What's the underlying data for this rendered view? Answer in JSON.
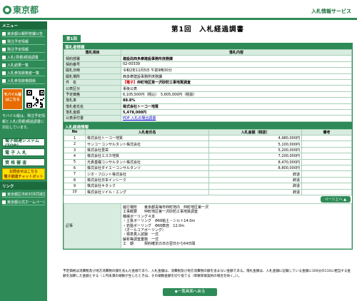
{
  "header": {
    "logo_text": "東京都",
    "service_title": "入札情報サービス"
  },
  "sidebar": {
    "menu_title": "メニュー",
    "items": [
      {
        "label": "東京都公報所管課公告"
      },
      {
        "label": "発注予定情報"
      },
      {
        "label": "発注予定情報"
      },
      {
        "label": "入札(見積)経過調書"
      },
      {
        "label": "入札結果一覧"
      },
      {
        "label": "入札参加資格者一覧"
      },
      {
        "label": "入札参加資格関係"
      }
    ],
    "mobile_button": "モバイル版はこちら",
    "mobile_text": "モバイル版は、発注予定情報と入札(見積)経過調書に対応しています。",
    "links": [
      {
        "label": "電子調達システム(TOP)"
      },
      {
        "label": "電 子 入 札"
      },
      {
        "label": "資 格 審 査"
      }
    ],
    "yellow_button_line1": "お問合せはこちら",
    "yellow_button_line2": "電子調達チャットボット",
    "links_title": "リンク",
    "link_items": [
      {
        "label": "東京都区市町村共同運営"
      },
      {
        "label": "東京都公式ホームページ"
      }
    ]
  },
  "main": {
    "title": "第1回　入札経過調書",
    "tab": "第1回",
    "info_header": "落札者情報",
    "info_col_item": "落札項目",
    "info_col_content": "落札内容",
    "info_rows": [
      {
        "label": "契約部署",
        "value": "建設局西多摩建設事務所庶務課"
      },
      {
        "label": "契約番号",
        "value": "02-00339"
      },
      {
        "label": "開札日時",
        "value": "令和2年11月5日 午前9時30分"
      },
      {
        "label": "開札場所",
        "value": "西多摩建設事務所庶務課"
      },
      {
        "label": "件　名",
        "value_prefix": "【電子】",
        "value": "仲町地区第一沢砂防工事地質調査"
      },
      {
        "label": "公表区分",
        "value": "事後公表"
      },
      {
        "label": "予定価格",
        "value": "6,105,500円（税込）　5,605,000円（税抜）"
      },
      {
        "label": "落札率",
        "value": "88.8%"
      },
      {
        "label": "落札者氏名",
        "value": "株式会社トーコー地質"
      },
      {
        "label": "落札金額",
        "value": "5,478,000円"
      },
      {
        "label": "公表添付書",
        "value": "PDF 入札の場合調書"
      }
    ],
    "bid_header": "入札経過情報",
    "bid_cols": [
      "No",
      "入札者氏名",
      "入札金額（税抜）",
      "備考"
    ],
    "bids": [
      {
        "no": "1",
        "name": "株式会社トーコー地質",
        "amount": "4,980,000円",
        "note": ""
      },
      {
        "no": "2",
        "name": "サンコーコンサルタント株式会社",
        "amount": "5,100,000円",
        "note": ""
      },
      {
        "no": "3",
        "name": "株式会社豊栄",
        "amount": "5,200,000円",
        "note": ""
      },
      {
        "no": "4",
        "name": "株式会社エスカ地質",
        "amount": "7,200,000円",
        "note": ""
      },
      {
        "no": "5",
        "name": "光貴基礎コンサルタント株式会社",
        "amount": "8,470,000円",
        "note": ""
      },
      {
        "no": "6",
        "name": "株式会社ダイエーコンサルタンツ",
        "amount": "8,800,000円",
        "note": ""
      },
      {
        "no": "7",
        "name": "ジオ・フロント株式会社",
        "amount": "辞退",
        "note": ""
      },
      {
        "no": "8",
        "name": "株式会社日本インシーク",
        "amount": "辞退",
        "note": ""
      },
      {
        "no": "9",
        "name": "株式会社キタック",
        "amount": "辞退",
        "note": ""
      },
      {
        "no": "10",
        "name": "株式会社ソイル・エング",
        "amount": "辞退",
        "note": ""
      }
    ],
    "back_button": "ページ上へ ▲",
    "remarks_label": "記事",
    "remarks_lines": [
      "履行場所　　東京都青梅市仲町地内　仲町地区第一沢",
      "工事概要　　仲町地区第一沢砂防工事地質調査",
      "機械ボーリング４本",
      "・土質ボーリング　Φ66粘土・シルト14.0m",
      "・岩盤ボーリング　Φ66軟岩　12.0m",
      "（オールコアボーリング）",
      "・標準貫入試験　一式",
      "解析等調査業務　一式",
      "工　期　　　契約確定の日の翌日から64日間"
    ]
  },
  "footer": {
    "note": "予定価格は消費税及び地方消費税の額を含んだ金額であり、入札金額は、消費税及び地方消費税の額を含まない金額である。落札金額は、入札金額に記載している金額に100分の110に相当する金額を加算した金額とする（１円未満の端数が生じたときは、その端数金額を切り捨てる（単数単価契約の場合を除く。））。",
    "list_button": "◆一覧画面へ戻る"
  }
}
